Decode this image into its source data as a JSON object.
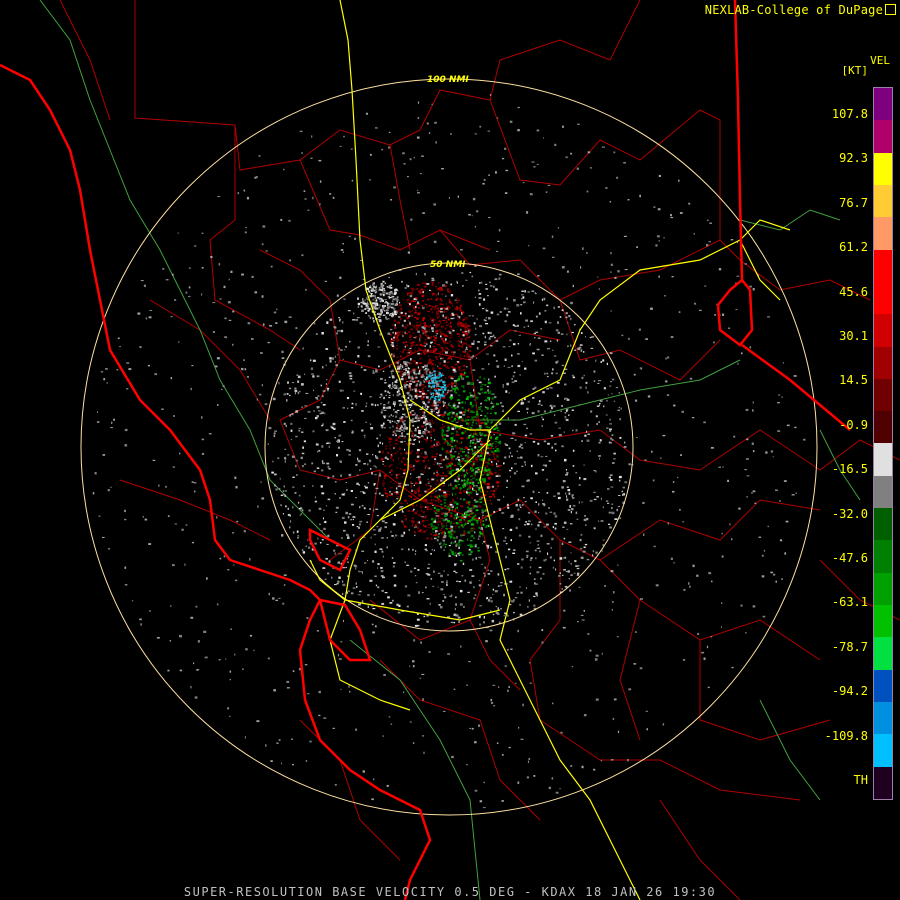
{
  "header": {
    "credit": "NEXLAB-College of DuPage"
  },
  "caption": "SUPER-RESOLUTION BASE VELOCITY 0.5 DEG - KDAX 18 JAN 26 19:30",
  "legend": {
    "title": "VEL",
    "unit": "[KT]",
    "labels": [
      "107.8",
      "92.3",
      "76.7",
      "61.2",
      "45.6",
      "30.1",
      "14.5",
      "-0.9",
      "-16.5",
      "-32.0",
      "-47.6",
      "-63.1",
      "-78.7",
      "-94.2",
      "-109.8",
      "TH"
    ],
    "colors": [
      "#7f007f",
      "#b0006a",
      "#ffff00",
      "#ffcc33",
      "#ff9966",
      "#ff0000",
      "#ff0000",
      "#d00000",
      "#a00000",
      "#700000",
      "#500000",
      "#e0e0e0",
      "#808080",
      "#006000",
      "#008000",
      "#00a000",
      "#00c000",
      "#00e040",
      "#0050c0",
      "#0090e0",
      "#00c0ff",
      "#200020"
    ]
  },
  "rings": {
    "inner_label": "50 NMI",
    "outer_label": "100 NMI"
  },
  "colors": {
    "background": "#000000",
    "state_border": "#ff0000",
    "county_border": "#b00000",
    "highway": "#ffff00",
    "river": "#40a040",
    "range_ring": "#ffe0a0",
    "text": "#ffff00"
  }
}
